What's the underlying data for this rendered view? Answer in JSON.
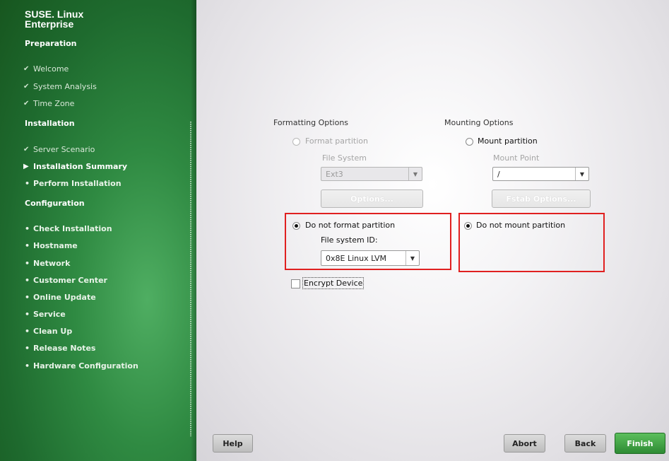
{
  "brand": {
    "line1": "SUSE. Linux",
    "line2": "Enterprise"
  },
  "sidebar": {
    "preparation_title": "Preparation",
    "preparation_steps": [
      "Welcome",
      "System Analysis",
      "Time Zone"
    ],
    "installation_title": "Installation",
    "installation_steps": [
      "Server Scenario",
      "Installation Summary",
      "Perform Installation"
    ],
    "configuration_title": "Configuration",
    "configuration_steps": [
      "Check Installation",
      "Hostname",
      "Network",
      "Customer Center",
      "Online Update",
      "Service",
      "Clean Up",
      "Release Notes",
      "Hardware Configuration"
    ]
  },
  "formatting": {
    "title": "Formatting Options",
    "format_partition": "Format partition",
    "file_system_label": "File System",
    "file_system_value": "Ext3",
    "options_button": "Options...",
    "do_not_format": "Do not format partition",
    "file_system_id_label": "File system ID:",
    "file_system_id_value": "0x8E Linux LVM",
    "encrypt_device": "Encrypt Device"
  },
  "mounting": {
    "title": "Mounting Options",
    "mount_partition": "Mount partition",
    "mount_point_label": "Mount Point",
    "mount_point_value": "/",
    "fstab_button": "Fstab Options...",
    "do_not_mount": "Do not mount partition"
  },
  "footer": {
    "help": "Help",
    "abort": "Abort",
    "back": "Back",
    "finish": "Finish"
  },
  "colors": {
    "accent": "#2e8b34",
    "highlight": "#e02020"
  }
}
